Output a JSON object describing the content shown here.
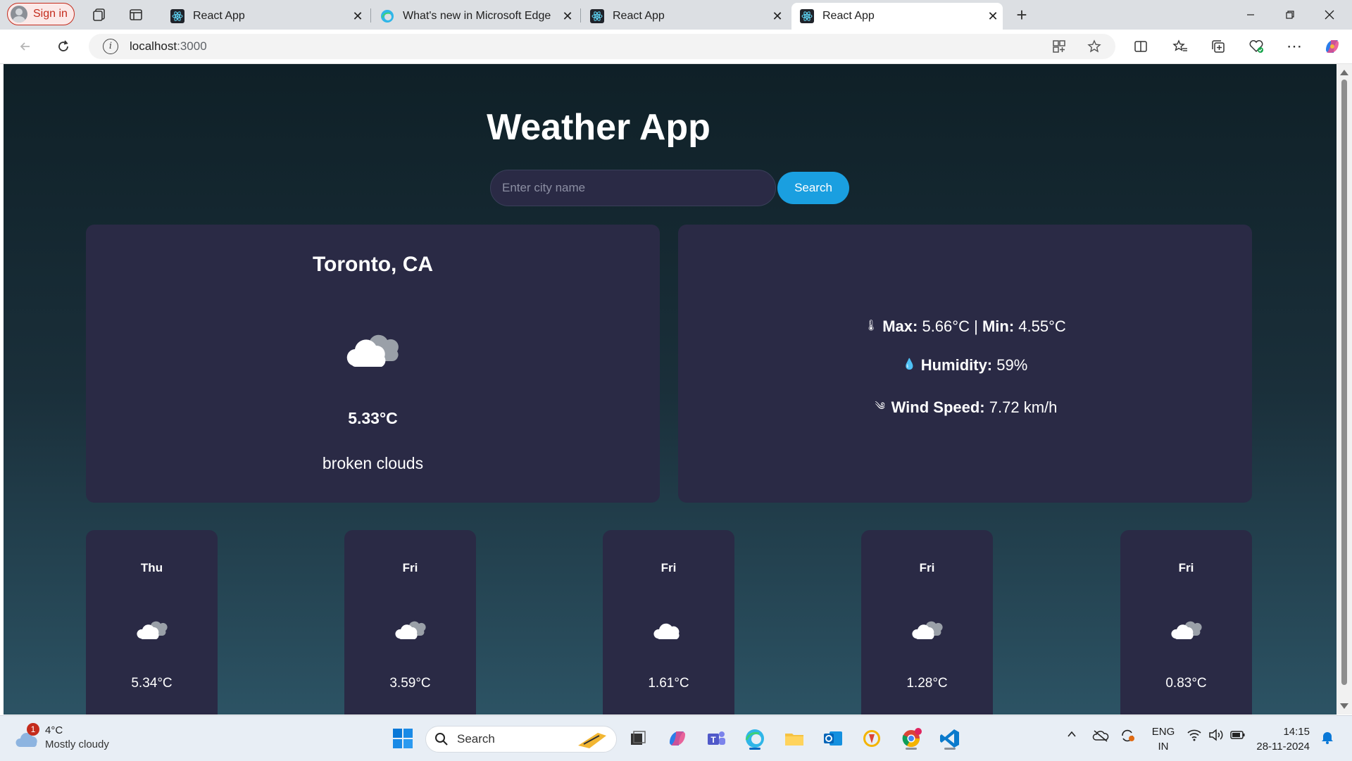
{
  "browser": {
    "signin_label": "Sign in",
    "tabs": [
      {
        "title": "React App"
      },
      {
        "title": "What's new in Microsoft Edge"
      },
      {
        "title": "React App"
      },
      {
        "title": "React App"
      }
    ],
    "url_host": "localhost",
    "url_port": ":3000"
  },
  "app": {
    "title": "Weather App",
    "search_placeholder": "Enter city name",
    "search_button": "Search",
    "current": {
      "city": "Toronto, CA",
      "icon": "broken-clouds-icon",
      "temperature": "5.33°C",
      "description": "broken clouds"
    },
    "details": {
      "max_label": "Max:",
      "max_value": "5.66°C",
      "separator": "|",
      "min_label": "Min:",
      "min_value": "4.55°C",
      "humidity_label": "Humidity:",
      "humidity_value": "59%",
      "wind_label": "Wind Speed:",
      "wind_value": "7.72 km/h"
    },
    "forecast": [
      {
        "day": "Thu",
        "icon": "broken-clouds-icon",
        "temp": "5.34°C"
      },
      {
        "day": "Fri",
        "icon": "broken-clouds-icon",
        "temp": "3.59°C"
      },
      {
        "day": "Fri",
        "icon": "overcast-clouds-icon",
        "temp": "1.61°C"
      },
      {
        "day": "Fri",
        "icon": "broken-clouds-icon",
        "temp": "1.28°C"
      },
      {
        "day": "Fri",
        "icon": "broken-clouds-icon",
        "temp": "0.83°C"
      }
    ]
  },
  "taskbar": {
    "weather_badge": "1",
    "weather_temp": "4°C",
    "weather_desc": "Mostly cloudy",
    "search_label": "Search",
    "lang_line1": "ENG",
    "lang_line2": "IN",
    "time": "14:15",
    "date": "28-11-2024"
  },
  "colors": {
    "accent": "#1a9fe0",
    "card": "#2a2a45",
    "page_top": "#0f2027",
    "page_bottom": "#2c5364"
  }
}
